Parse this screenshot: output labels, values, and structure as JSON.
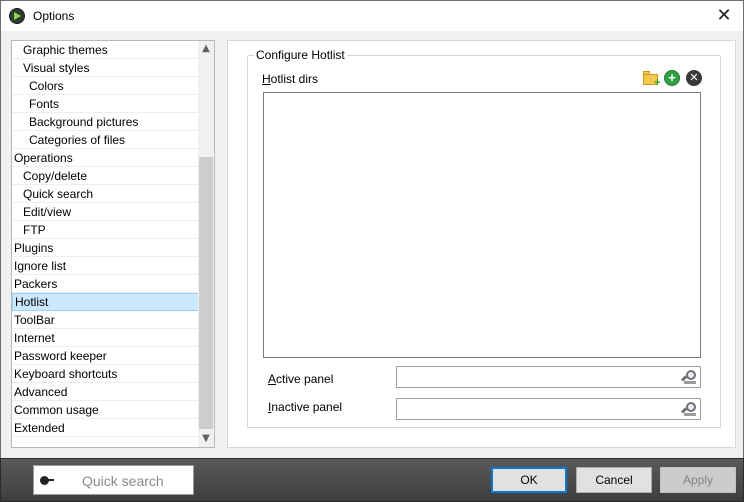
{
  "window": {
    "title": "Options"
  },
  "sidebar": {
    "items": [
      {
        "label": "Graphic themes",
        "level": 1
      },
      {
        "label": "Visual styles",
        "level": 1
      },
      {
        "label": "Colors",
        "level": 2
      },
      {
        "label": "Fonts",
        "level": 2
      },
      {
        "label": "Background pictures",
        "level": 2
      },
      {
        "label": "Categories of files",
        "level": 2
      },
      {
        "label": "Operations",
        "level": 0
      },
      {
        "label": "Copy/delete",
        "level": 1
      },
      {
        "label": "Quick search",
        "level": 1
      },
      {
        "label": "Edit/view",
        "level": 1
      },
      {
        "label": "FTP",
        "level": 1
      },
      {
        "label": "Plugins",
        "level": 0
      },
      {
        "label": "Ignore list",
        "level": 0
      },
      {
        "label": "Packers",
        "level": 0
      },
      {
        "label": "Hotlist",
        "level": 0,
        "selected": true
      },
      {
        "label": "ToolBar",
        "level": 0
      },
      {
        "label": "Internet",
        "level": 0
      },
      {
        "label": "Password keeper",
        "level": 0
      },
      {
        "label": "Keyboard shortcuts",
        "level": 0
      },
      {
        "label": "Advanced",
        "level": 0
      },
      {
        "label": "Common usage",
        "level": 0
      },
      {
        "label": "Extended",
        "level": 0
      }
    ]
  },
  "panel": {
    "group_title": "Configure Hotlist",
    "dirs_label_access": "H",
    "dirs_label_rest": "otlist dirs",
    "active_label_access": "A",
    "active_label_rest": "ctive panel",
    "active_value": "",
    "inactive_label_access": "I",
    "inactive_label_rest": "nactive panel",
    "inactive_value": ""
  },
  "icons": {
    "add_folder": "folder-add-icon",
    "add": "plus-circle-icon",
    "remove": "x-circle-icon",
    "browse": "magnifier-icon"
  },
  "footer": {
    "quick_search_placeholder": "Quick search",
    "ok_label": "OK",
    "cancel_label": "Cancel",
    "apply_label": "Apply"
  },
  "colors": {
    "selection_bg": "#cce8ff",
    "default_button_border": "#0078d7",
    "footer_bg": "#4a4a4a"
  }
}
